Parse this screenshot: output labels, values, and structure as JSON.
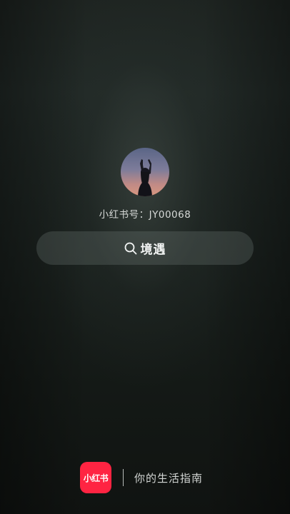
{
  "profile": {
    "id_label": "小红书号：JY00068",
    "avatar": "avatar-photo"
  },
  "search": {
    "icon": "search-icon",
    "label": "境遇"
  },
  "footer": {
    "logo_text": "小红书",
    "slogan": "你的生活指南"
  },
  "colors": {
    "brand": "#ff2442",
    "background": "#1a201d"
  }
}
